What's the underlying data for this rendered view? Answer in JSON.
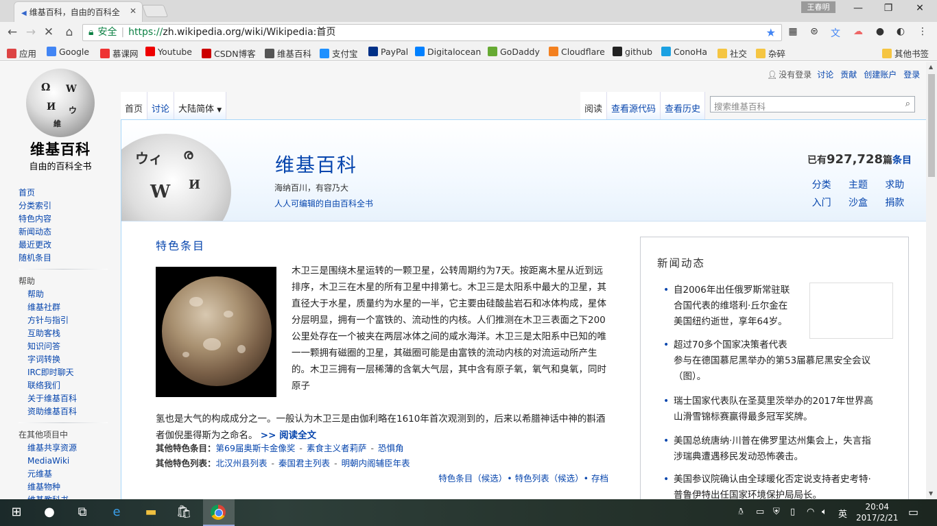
{
  "browser": {
    "tab_title": "维基百科，自由的百科全",
    "user_chip": "王春明",
    "url_secure_label": "安全",
    "url_proto": "https://",
    "url_host_path": "zh.wikipedia.org/wiki/Wikipedia:首页"
  },
  "bookmarks": [
    {
      "label": "应用",
      "color": "#d44"
    },
    {
      "label": "Google",
      "color": "#4285f4"
    },
    {
      "label": "慕课网",
      "color": "#e33"
    },
    {
      "label": "Youtube",
      "color": "#e00"
    },
    {
      "label": "CSDN博客",
      "color": "#c00"
    },
    {
      "label": "维基百科",
      "color": "#555"
    },
    {
      "label": "支付宝",
      "color": "#1e90ff"
    },
    {
      "label": "PayPal",
      "color": "#003087"
    },
    {
      "label": "Digitalocean",
      "color": "#0080ff"
    },
    {
      "label": "GoDaddy",
      "color": "#6a3"
    },
    {
      "label": "Cloudflare",
      "color": "#f38020"
    },
    {
      "label": "github",
      "color": "#222"
    },
    {
      "label": "ConoHa",
      "color": "#1ba1e2"
    },
    {
      "label": "社交",
      "color": "#f5c542"
    },
    {
      "label": "杂碎",
      "color": "#f5c542"
    },
    {
      "label": "其他书签",
      "color": "#f5c542"
    }
  ],
  "wiki": {
    "logo_title": "维基百科",
    "logo_subtitle": "自由的百科全书",
    "personal": {
      "not_logged_in": "没有登录",
      "talk": "讨论",
      "contributions": "贡献",
      "create_account": "创建账户",
      "login": "登录"
    },
    "tabs_left": {
      "main": "首页",
      "talk": "讨论",
      "variant": "大陆简体"
    },
    "tabs_right": {
      "read": "阅读",
      "view_source": "查看源代码",
      "history": "查看历史"
    },
    "search_placeholder": "搜索维基百科",
    "sidebar_nav": [
      "首页",
      "分类索引",
      "特色内容",
      "新闻动态",
      "最近更改",
      "随机条目"
    ],
    "sidebar_help_heading": "帮助",
    "sidebar_help": [
      "帮助",
      "维基社群",
      "方针与指引",
      "互助客栈",
      "知识问答",
      "字词转换",
      "IRC即时聊天",
      "联络我们",
      "关于维基百科",
      "资助维基百科"
    ],
    "sidebar_other_heading": "在其他项目中",
    "sidebar_other": [
      "维基共享资源",
      "MediaWiki",
      "元维基",
      "维基物种",
      "维基教科书"
    ]
  },
  "banner": {
    "title": "维基百科",
    "tagline": "海纳百川，有容乃大",
    "tagline2": "人人可编辑的自由百科全书",
    "count_prefix": "已有",
    "count": "927,728",
    "count_mid": "篇",
    "count_link": "条目",
    "quicklinks": [
      "分类",
      "主题",
      "求助",
      "入门",
      "沙盒",
      "捐款"
    ]
  },
  "featured": {
    "heading": "特色条目",
    "body": "木卫三是围绕木星运转的一颗卫星，公转周期约为7天。按距离木星从近到远排序，木卫三在木星的所有卫星中排第七。木卫三是太阳系中最大的卫星，其直径大于水星，质量约为水星的一半，它主要由硅酸盐岩石和冰体构成，星体分层明显，拥有一个富铁的、流动性的内核。人们推测在木卫三表面之下200公里处存在一个被夹在两层冰体之间的咸水海洋。木卫三是太阳系中已知的唯一一颗拥有磁圈的卫星，其磁圈可能是由富铁的流动内核的对流运动所产生的。木卫三拥有一层稀薄的含氧大气层，其中含有原子氧，氧气和臭氧，同时原子",
    "body_tail": "氢也是大气的构成成分之一。一般认为木卫三是由伽利略在1610年首次观测到的，后来以希腊神话中神的斟酒者伽倪墨得斯为之命名。",
    "read_more": ">> 阅读全文",
    "other_articles_label": "其他特色条目：",
    "other_articles": [
      "第69届奥斯卡金像奖",
      "素食主义者莉萨",
      "恐惧角"
    ],
    "other_lists_label": "其他特色列表：",
    "other_lists": [
      "北汉州县列表",
      "秦国君主列表",
      "明朝内阁辅臣年表"
    ],
    "footer": "特色条目（候选）• 特色列表（候选）• 存档"
  },
  "news": {
    "heading": "新闻动态",
    "items": [
      {
        "line1": "自2006年出任俄罗斯常驻联",
        "line2": "合国代表的维塔利·丘尔金在",
        "line3": "美国纽约逝世，享年64岁。"
      },
      {
        "line1": "超过70多个国家决策者代表",
        "line2": "参与在德国慕尼黑举办的第53届慕尼黑安全会议",
        "line3": "（图）。"
      },
      {
        "line1": "瑞士国家代表队在圣莫里茨举办的2017年世界高",
        "line2": "山滑雪锦标赛赢得最多冠军奖牌。"
      },
      {
        "line1": "美国总统唐纳·川普在佛罗里达州集会上，失言指",
        "line2": "涉瑞典遭遇移民发动恐怖袭击。"
      },
      {
        "line1": "美国参议院确认由全球暖化否定说支持者史考特·",
        "line2": "普鲁伊特出任国家环境保护局局长。"
      }
    ]
  },
  "taskbar": {
    "time": "20:04",
    "date": "2017/2/21",
    "ime": "英"
  }
}
